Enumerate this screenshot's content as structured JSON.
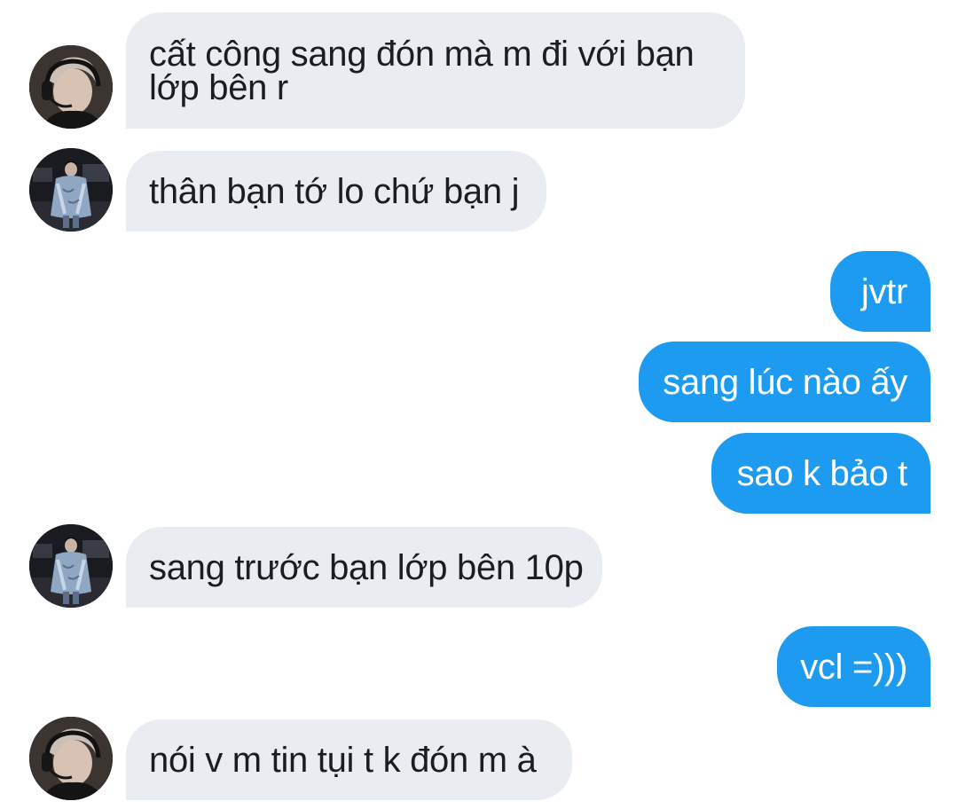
{
  "colors": {
    "incoming_bubble": "#e9ecf0",
    "incoming_text": "#1b1d21",
    "outgoing_bubble": "#1d9bf0",
    "outgoing_text": "#ffffff"
  },
  "messages": [
    {
      "direction": "in",
      "avatar": "headset-boy-avatar-icon",
      "text": "cất công sang đón mà m đi với bạn lớp bên r"
    },
    {
      "direction": "in",
      "avatar": "denim-jacket-avatar-icon",
      "text": "thân bạn tớ lo chứ bạn j"
    },
    {
      "direction": "out",
      "text": "jvtr"
    },
    {
      "direction": "out",
      "text": "sang lúc nào ấy"
    },
    {
      "direction": "out",
      "text": "sao k bảo t"
    },
    {
      "direction": "in",
      "avatar": "denim-jacket-avatar-icon",
      "text": "sang trước bạn lớp bên 10p"
    },
    {
      "direction": "out",
      "text": "vcl =)))"
    },
    {
      "direction": "in",
      "avatar": "headset-boy-avatar-icon",
      "text": "nói v m tin tụi t k đón m à"
    }
  ]
}
